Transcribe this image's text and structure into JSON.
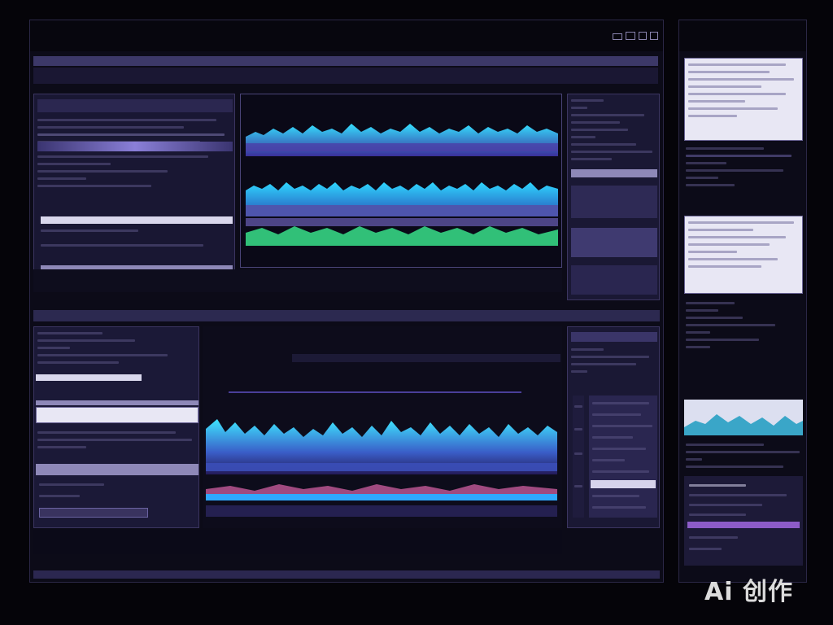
{
  "main_window": {
    "title": "",
    "toolbar_text": ""
  },
  "left_top_panel": {
    "row_count": 14
  },
  "waveform_top": {
    "note": ""
  },
  "right_top_panel": {
    "row_count": 16
  },
  "lower_section": {
    "label_left": "",
    "label_right": "",
    "subtitle": ""
  },
  "lower_left_panel": {
    "footer_text": ""
  },
  "lower_right_panel": {
    "row_count": 14
  },
  "side_window": {
    "title": ""
  },
  "watermark": {
    "text": "Ai 创作"
  },
  "colors": {
    "background": "#050409",
    "panel": "#14122a",
    "accent_cyan": "#2fd6ff",
    "accent_purple": "#7b5cff",
    "accent_green": "#38e08a"
  }
}
